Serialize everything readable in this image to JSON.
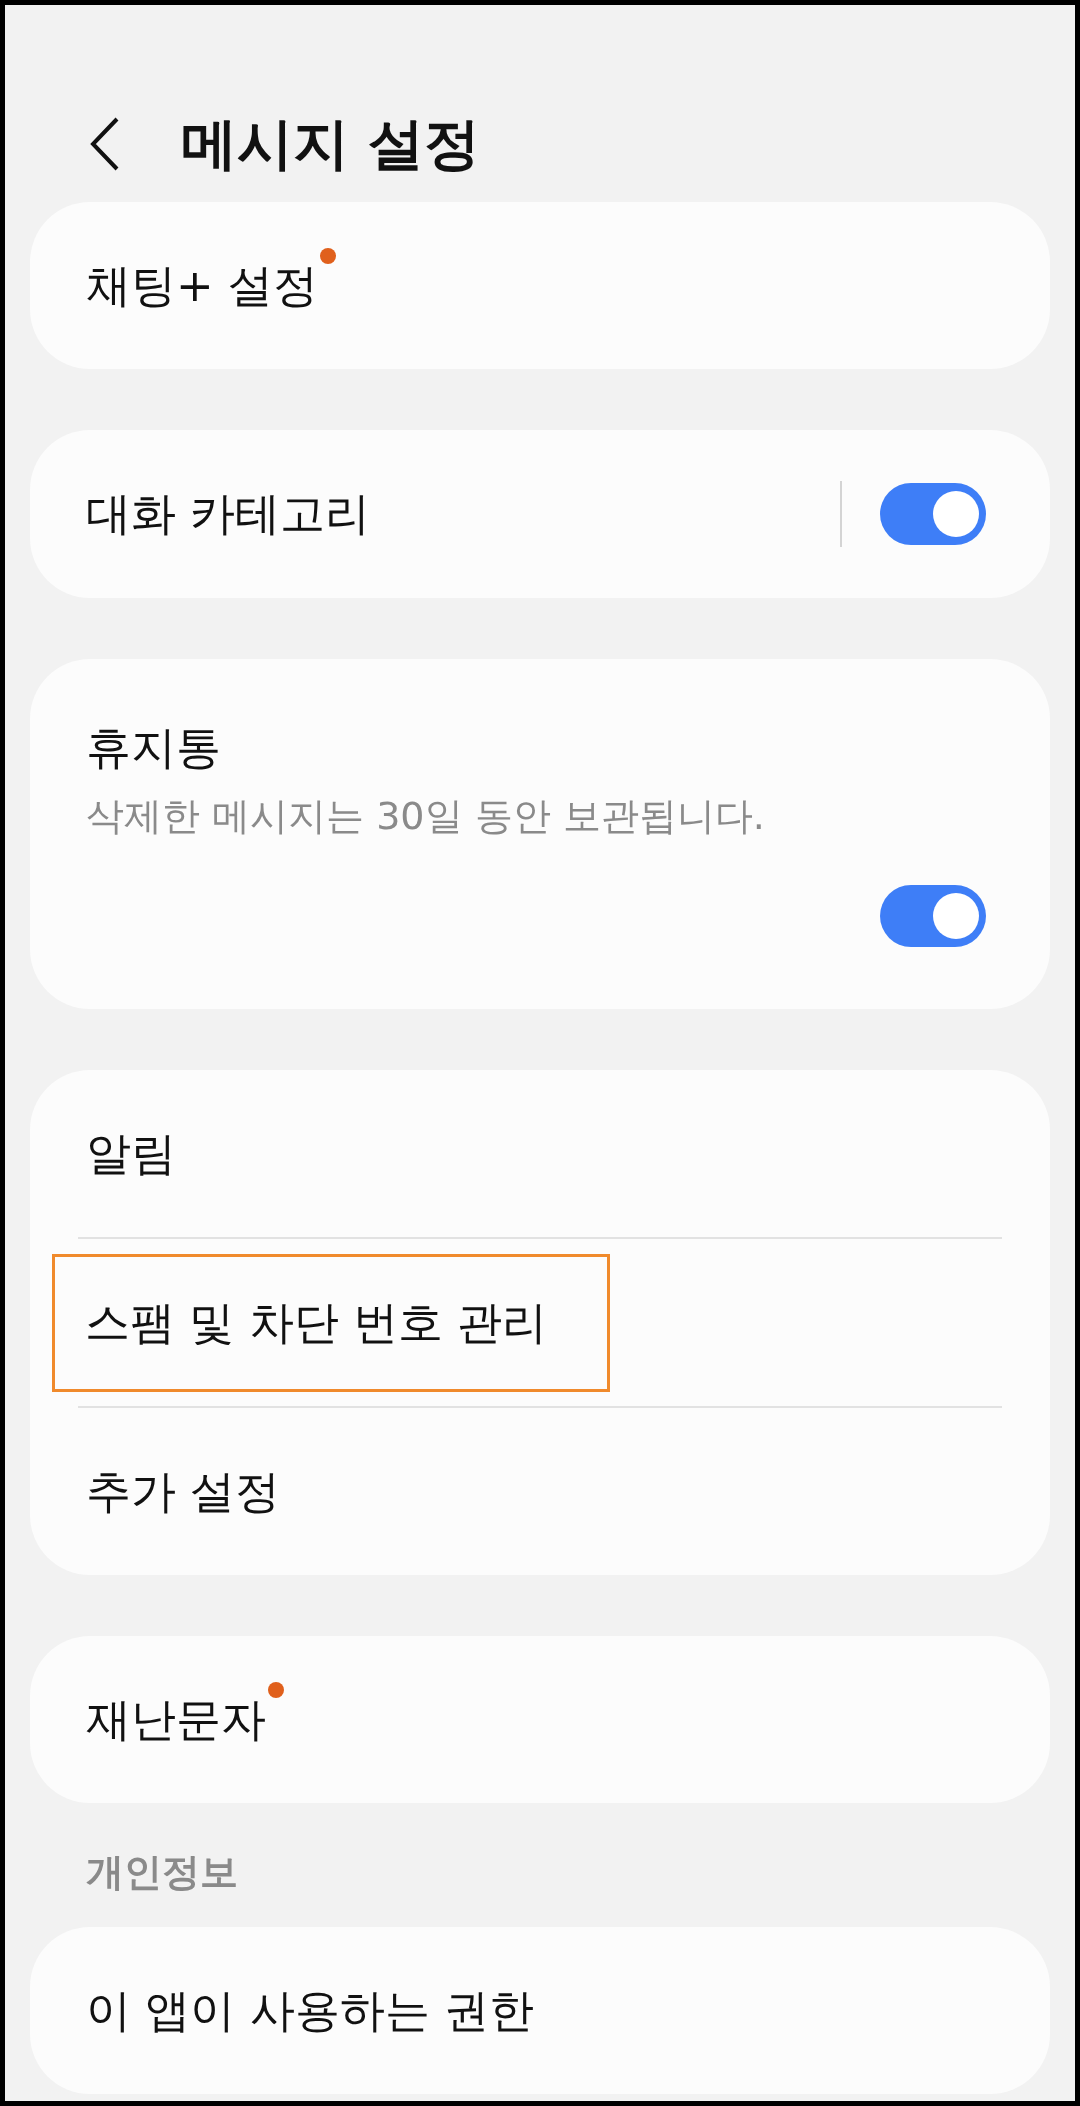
{
  "header": {
    "title": "메시지 설정"
  },
  "groups": [
    {
      "items": [
        {
          "kind": "link",
          "label": "채팅+ 설정",
          "new_badge": true,
          "highlighted": false
        }
      ]
    },
    {
      "items": [
        {
          "kind": "switch",
          "label": "대화 카테고리",
          "on": true
        }
      ]
    },
    {
      "items": [
        {
          "kind": "switch_below",
          "label": "휴지통",
          "subtitle": "삭제한 메시지는 30일 동안 보관됩니다.",
          "on": true
        }
      ]
    },
    {
      "items": [
        {
          "kind": "link",
          "label": "알림",
          "new_badge": false,
          "highlighted": false
        },
        {
          "kind": "link",
          "label": "스팸 및 차단 번호 관리",
          "new_badge": false,
          "highlighted": true
        },
        {
          "kind": "link",
          "label": "추가 설정",
          "new_badge": false,
          "highlighted": false
        }
      ]
    },
    {
      "items": [
        {
          "kind": "link",
          "label": "재난문자",
          "new_badge": true,
          "highlighted": false
        }
      ]
    },
    {
      "section": "개인정보",
      "items": [
        {
          "kind": "link",
          "label": "이 앱이 사용하는 권한",
          "new_badge": false,
          "highlighted": false
        }
      ]
    }
  ]
}
